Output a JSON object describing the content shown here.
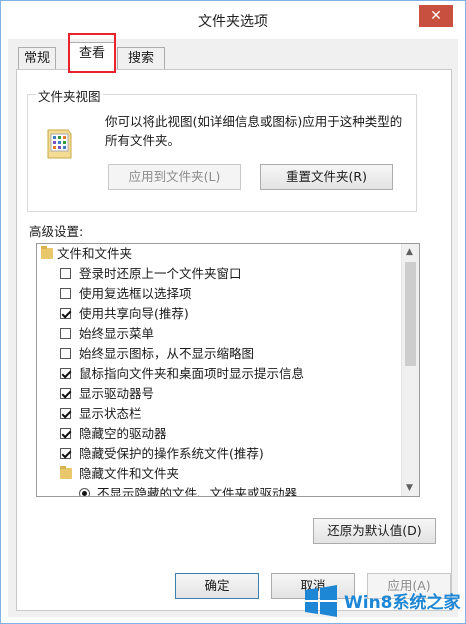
{
  "window": {
    "title": "文件夹选项",
    "close_glyph": "✕"
  },
  "tabs": [
    {
      "label": "常规"
    },
    {
      "label": "查看",
      "active": true
    },
    {
      "label": "搜索"
    }
  ],
  "folder_views": {
    "group_title": "文件夹视图",
    "description": "你可以将此视图(如详细信息或图标)应用于这种类型的所有文件夹。",
    "apply_button": "应用到文件夹(L)",
    "reset_button": "重置文件夹(R)"
  },
  "advanced": {
    "label": "高级设置:",
    "items": [
      {
        "type": "folder",
        "indent": 0,
        "label": "文件和文件夹"
      },
      {
        "type": "checkbox",
        "indent": 1,
        "checked": false,
        "label": "登录时还原上一个文件夹窗口"
      },
      {
        "type": "checkbox",
        "indent": 1,
        "checked": false,
        "label": "使用复选框以选择项"
      },
      {
        "type": "checkbox",
        "indent": 1,
        "checked": true,
        "label": "使用共享向导(推荐)"
      },
      {
        "type": "checkbox",
        "indent": 1,
        "checked": false,
        "label": "始终显示菜单"
      },
      {
        "type": "checkbox",
        "indent": 1,
        "checked": false,
        "label": "始终显示图标，从不显示缩略图"
      },
      {
        "type": "checkbox",
        "indent": 1,
        "checked": true,
        "label": "鼠标指向文件夹和桌面项时显示提示信息"
      },
      {
        "type": "checkbox",
        "indent": 1,
        "checked": true,
        "label": "显示驱动器号"
      },
      {
        "type": "checkbox",
        "indent": 1,
        "checked": true,
        "label": "显示状态栏"
      },
      {
        "type": "checkbox",
        "indent": 1,
        "checked": true,
        "label": "隐藏空的驱动器"
      },
      {
        "type": "checkbox",
        "indent": 1,
        "checked": true,
        "label": "隐藏受保护的操作系统文件(推荐)"
      },
      {
        "type": "folder",
        "indent": 1,
        "label": "隐藏文件和文件夹"
      },
      {
        "type": "radio",
        "indent": 2,
        "checked": true,
        "label": "不显示隐藏的文件、文件夹或驱动器"
      }
    ],
    "restore_defaults_button": "还原为默认值(D)"
  },
  "footer": {
    "ok": "确定",
    "cancel": "取消",
    "apply": "应用(A)"
  },
  "watermark": {
    "text": "Win8系统之家"
  },
  "colors": {
    "highlight_box": "#e8232b",
    "accent": "#1d87d6"
  }
}
